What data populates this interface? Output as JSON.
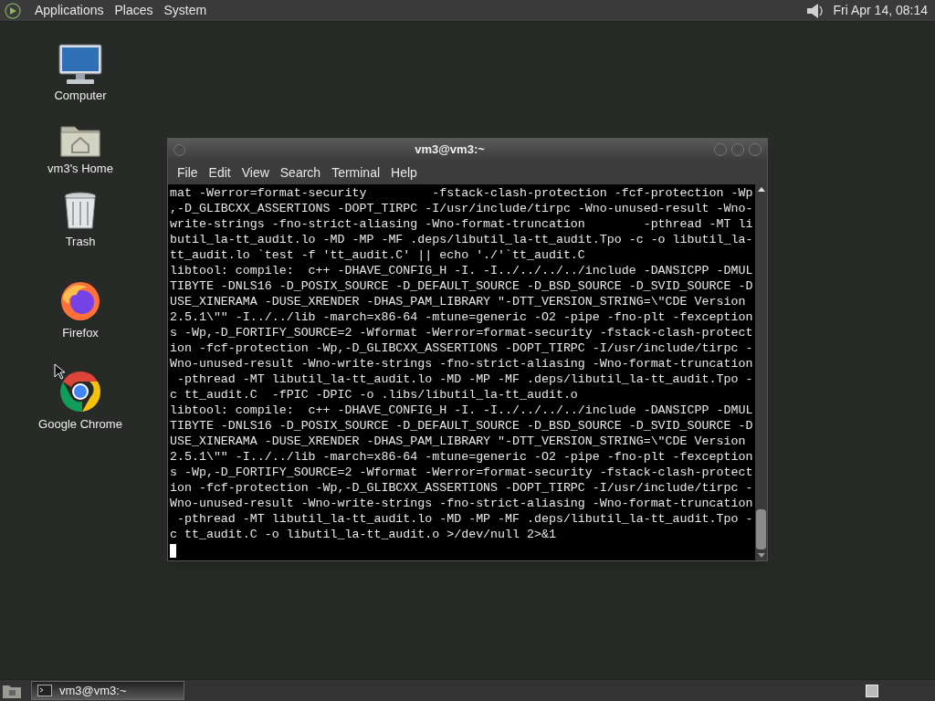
{
  "top_panel": {
    "menus": [
      "Applications",
      "Places",
      "System"
    ],
    "clock": "Fri Apr 14, 08:14"
  },
  "desktop_icons": [
    {
      "label": "Computer",
      "kind": "computer"
    },
    {
      "label": "vm3's Home",
      "kind": "home"
    },
    {
      "label": "Trash",
      "kind": "trash"
    },
    {
      "label": "Firefox",
      "kind": "firefox"
    },
    {
      "label": "Google Chrome",
      "kind": "chrome"
    }
  ],
  "terminal": {
    "title": "vm3@vm3:~",
    "menu": [
      "File",
      "Edit",
      "View",
      "Search",
      "Terminal",
      "Help"
    ],
    "lines": [
      "mat -Werror=format-security         -fstack-clash-protection -fcf-protection -Wp",
      ",-D_GLIBCXX_ASSERTIONS -DOPT_TIRPC -I/usr/include/tirpc -Wno-unused-result -Wno-",
      "write-strings -fno-strict-aliasing -Wno-format-truncation        -pthread -MT li",
      "butil_la-tt_audit.lo -MD -MP -MF .deps/libutil_la-tt_audit.Tpo -c -o libutil_la-",
      "tt_audit.lo `test -f 'tt_audit.C' || echo './'`tt_audit.C",
      "libtool: compile:  c++ -DHAVE_CONFIG_H -I. -I../../../../include -DANSICPP -DMUL",
      "TIBYTE -DNLS16 -D_POSIX_SOURCE -D_DEFAULT_SOURCE -D_BSD_SOURCE -D_SVID_SOURCE -D",
      "USE_XINERAMA -DUSE_XRENDER -DHAS_PAM_LIBRARY \"-DTT_VERSION_STRING=\\\"CDE Version",
      "2.5.1\\\"\" -I../../lib -march=x86-64 -mtune=generic -O2 -pipe -fno-plt -fexception",
      "s -Wp,-D_FORTIFY_SOURCE=2 -Wformat -Werror=format-security -fstack-clash-protect",
      "ion -fcf-protection -Wp,-D_GLIBCXX_ASSERTIONS -DOPT_TIRPC -I/usr/include/tirpc -",
      "Wno-unused-result -Wno-write-strings -fno-strict-aliasing -Wno-format-truncation",
      " -pthread -MT libutil_la-tt_audit.lo -MD -MP -MF .deps/libutil_la-tt_audit.Tpo -",
      "c tt_audit.C  -fPIC -DPIC -o .libs/libutil_la-tt_audit.o",
      "libtool: compile:  c++ -DHAVE_CONFIG_H -I. -I../../../../include -DANSICPP -DMUL",
      "TIBYTE -DNLS16 -D_POSIX_SOURCE -D_DEFAULT_SOURCE -D_BSD_SOURCE -D_SVID_SOURCE -D",
      "USE_XINERAMA -DUSE_XRENDER -DHAS_PAM_LIBRARY \"-DTT_VERSION_STRING=\\\"CDE Version",
      "2.5.1\\\"\" -I../../lib -march=x86-64 -mtune=generic -O2 -pipe -fno-plt -fexception",
      "s -Wp,-D_FORTIFY_SOURCE=2 -Wformat -Werror=format-security -fstack-clash-protect",
      "ion -fcf-protection -Wp,-D_GLIBCXX_ASSERTIONS -DOPT_TIRPC -I/usr/include/tirpc -",
      "Wno-unused-result -Wno-write-strings -fno-strict-aliasing -Wno-format-truncation",
      " -pthread -MT libutil_la-tt_audit.lo -MD -MP -MF .deps/libutil_la-tt_audit.Tpo -",
      "c tt_audit.C -o libutil_la-tt_audit.o >/dev/null 2>&1"
    ]
  },
  "taskbar": {
    "tasks": [
      {
        "label": "vm3@vm3:~",
        "selected": true
      }
    ]
  }
}
